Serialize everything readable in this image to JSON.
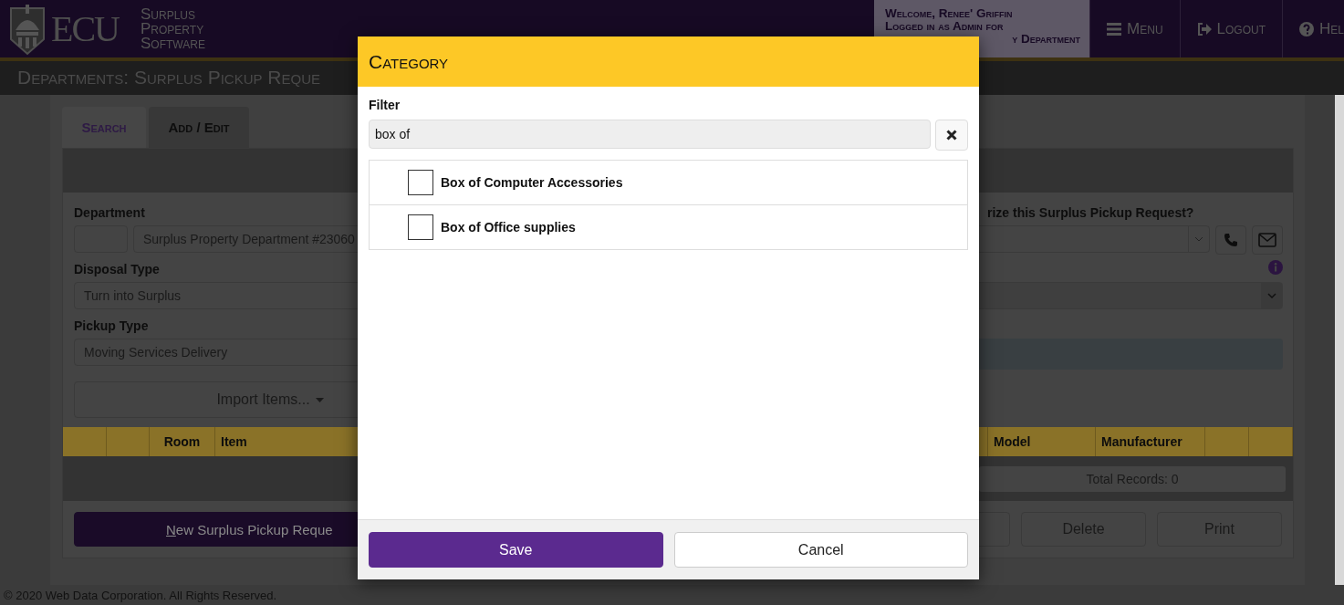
{
  "header": {
    "logo_text": "ECU",
    "app_name": [
      "Surplus",
      "Property",
      "Software"
    ],
    "welcome": [
      "Welcome, Renee' Griffin",
      "Logged in as Admin for",
      "y Department"
    ],
    "nav": [
      {
        "kind": "menu",
        "label": "Menu"
      },
      {
        "kind": "logout",
        "label": "Logout"
      },
      {
        "kind": "help",
        "label": "Hel"
      }
    ]
  },
  "page_title": "Departments: Surplus Pickup Reque",
  "tabs": [
    {
      "label": "Search",
      "selected": false
    },
    {
      "label": "Add / Edit",
      "selected": true
    }
  ],
  "form": {
    "department": {
      "label": "Department",
      "value": "Surplus Property Department #23060"
    },
    "authorize": {
      "label": "rize this Surplus Pickup Request?"
    },
    "disposal_type": {
      "label": "Disposal Type",
      "value": "Turn into Surplus"
    },
    "pickup_type": {
      "label": "Pickup Type",
      "value": "Moving Services Delivery"
    },
    "import_button": "Import Items..."
  },
  "table": {
    "columns_left": [
      "Room",
      "Item"
    ],
    "columns_right": [
      "Model",
      "Manufacturer"
    ],
    "total_records": "Total Records: 0"
  },
  "actions": {
    "new_button": "New Surplus Pickup Reque",
    "delete": "Delete",
    "print": "Print"
  },
  "footer": "© 2020 Web Data Corporation. All Rights Reserved.",
  "dialog": {
    "title": "Category",
    "filter_label": "Filter",
    "filter_value": "box of",
    "items": [
      {
        "label": "Box of Computer Accessories",
        "checked": false
      },
      {
        "label": "Box of Office supplies",
        "checked": false
      }
    ],
    "save": "Save",
    "cancel": "Cancel"
  }
}
